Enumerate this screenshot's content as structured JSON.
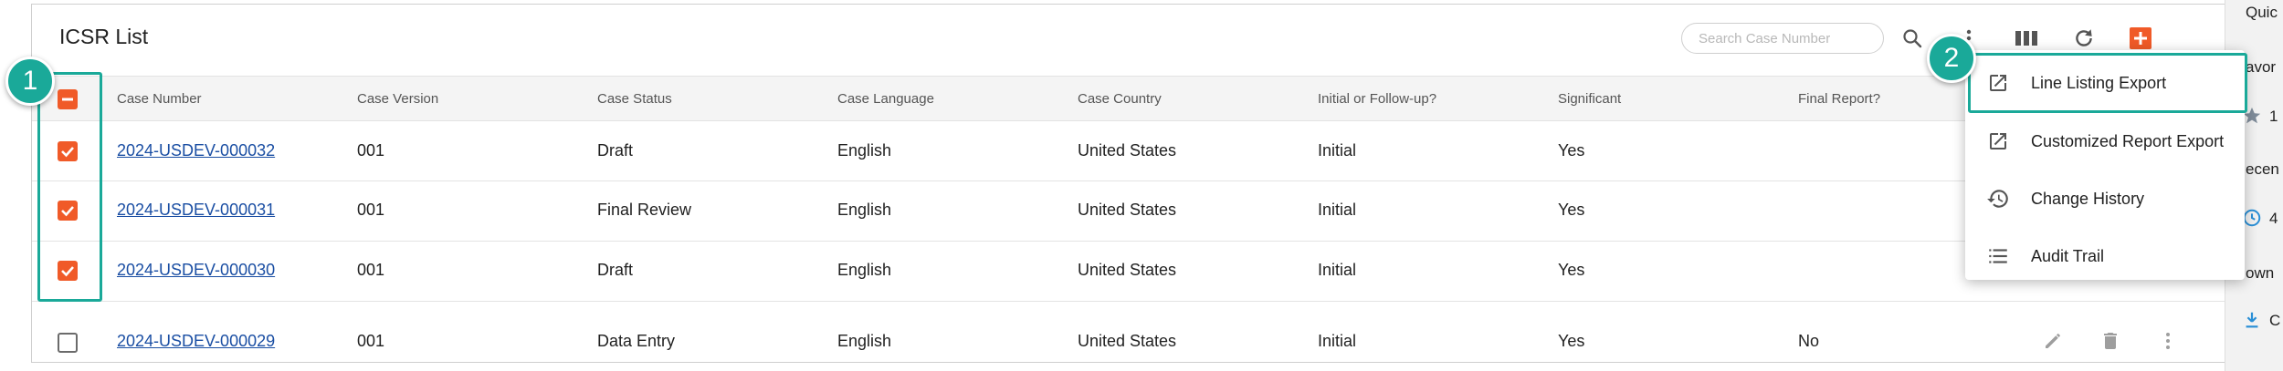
{
  "card": {
    "title": "ICSR List",
    "search_placeholder": "Search Case Number"
  },
  "toolbar": {
    "icons": [
      "search-icon",
      "more-vert-icon",
      "columns-icon",
      "refresh-icon",
      "add-icon"
    ],
    "accent": "#f05a28"
  },
  "table": {
    "headers": [
      "Case Number",
      "Case Version",
      "Case Status",
      "Case Language",
      "Case Country",
      "Initial or Follow-up?",
      "Significant",
      "Final Report?"
    ],
    "rows": [
      {
        "checked": true,
        "case_number": "2024-USDEV-000032",
        "version": "001",
        "status": "Draft",
        "language": "English",
        "country": "United States",
        "initial": "Initial",
        "significant": "Yes",
        "final": ""
      },
      {
        "checked": true,
        "case_number": "2024-USDEV-000031",
        "version": "001",
        "status": "Final Review",
        "language": "English",
        "country": "United States",
        "initial": "Initial",
        "significant": "Yes",
        "final": ""
      },
      {
        "checked": true,
        "case_number": "2024-USDEV-000030",
        "version": "001",
        "status": "Draft",
        "language": "English",
        "country": "United States",
        "initial": "Initial",
        "significant": "Yes",
        "final": ""
      },
      {
        "checked": false,
        "case_number": "2024-USDEV-000029",
        "version": "001",
        "status": "Data Entry",
        "language": "English",
        "country": "United States",
        "initial": "Initial",
        "significant": "Yes",
        "final": "No"
      }
    ]
  },
  "menu": {
    "items": [
      {
        "label": "Line Listing Export",
        "icon": "open-in-new-icon"
      },
      {
        "label": "Customized Report Export",
        "icon": "open-in-new-icon"
      },
      {
        "label": "Change History",
        "icon": "history-icon"
      },
      {
        "label": "Audit Trail",
        "icon": "list-icon"
      }
    ]
  },
  "callouts": {
    "one": "1",
    "two": "2",
    "color": "#1aa999"
  },
  "side_panel": {
    "labels": [
      "Quic",
      "avor",
      "ecen",
      "own"
    ],
    "digits": [
      "1",
      "4",
      "C"
    ]
  }
}
